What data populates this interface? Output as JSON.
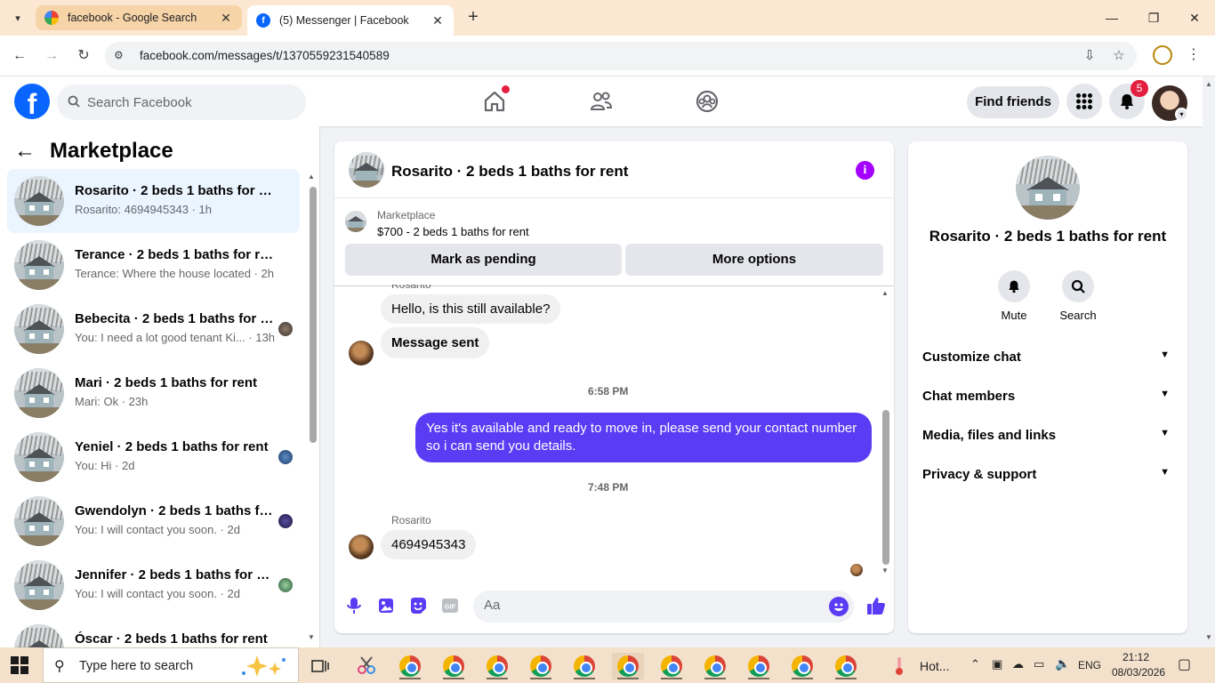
{
  "browser": {
    "tabs": [
      {
        "title": "facebook - Google Search",
        "active": false,
        "icon": "google-icon"
      },
      {
        "title": "(5) Messenger | Facebook",
        "active": true,
        "icon": "facebook-icon"
      }
    ],
    "url": "facebook.com/messages/t/1370559231540589",
    "colors": {
      "tabbar": "#fce8d2",
      "active_tab": "#ffffff"
    }
  },
  "fb_header": {
    "logo_letter": "f",
    "search_placeholder": "Search Facebook",
    "nav_icons": [
      "home-icon",
      "friends-icon",
      "groups-icon"
    ],
    "find_friends_label": "Find friends",
    "notification_count": "5",
    "brand_color": "#0866ff"
  },
  "marketplace": {
    "title": "Marketplace",
    "conversations": [
      {
        "title": "Rosarito · 2 beds 1 baths for rent",
        "subtitle": "Rosarito: 4694945343 · 1h",
        "selected": true
      },
      {
        "title": "Terance · 2 beds 1 baths for rent",
        "subtitle": "Terance: Where the house located · 2h",
        "selected": false
      },
      {
        "title": "Bebecita · 2 beds 1 baths for r...",
        "subtitle": "You: I need a lot good tenant Ki... · 13h",
        "selected": false
      },
      {
        "title": "Mari · 2 beds 1 baths for rent",
        "subtitle": "Mari: Ok · 23h",
        "selected": false
      },
      {
        "title": "Yeniel · 2 beds 1 baths for rent",
        "subtitle": "You: Hi · 2d",
        "selected": false
      },
      {
        "title": "Gwendolyn · 2 beds 1 baths fo...",
        "subtitle": "You: I will contact you soon. · 2d",
        "selected": false
      },
      {
        "title": "Jennifer · 2 beds 1 baths for re...",
        "subtitle": "You: I will contact you soon. · 2d",
        "selected": false
      },
      {
        "title": "Óscar · 2 beds 1 baths for rent",
        "subtitle": "",
        "selected": false
      }
    ]
  },
  "chat": {
    "title": "Rosarito · 2 beds 1 baths for rent",
    "marketplace_label": "Marketplace",
    "listing": "$700 - 2 beds 1 baths for rent",
    "mark_pending_label": "Mark as pending",
    "more_options_label": "More options",
    "messages": {
      "sender_top": "Rosarito",
      "msg1": "Hello, is this still available?",
      "msg2": "Message sent",
      "time1": "6:58 PM",
      "reply": "Yes it's available and ready to move in, please send your contact number so i can send you details.",
      "time2": "7:48 PM",
      "sender_bottom": "Rosarito",
      "msg3": "4694945343"
    },
    "composer_placeholder": "Aa",
    "accent_color": "#5b3cf5"
  },
  "details": {
    "title": "Rosarito · 2 beds 1 baths for rent",
    "mute_label": "Mute",
    "search_label": "Search",
    "sections": [
      "Customize chat",
      "Chat members",
      "Media, files and links",
      "Privacy & support"
    ]
  },
  "taskbar": {
    "search_placeholder": "Type here to search",
    "weather_text": "Hot...",
    "language": "ENG",
    "time": "21:12",
    "date": "08/03/2026"
  }
}
